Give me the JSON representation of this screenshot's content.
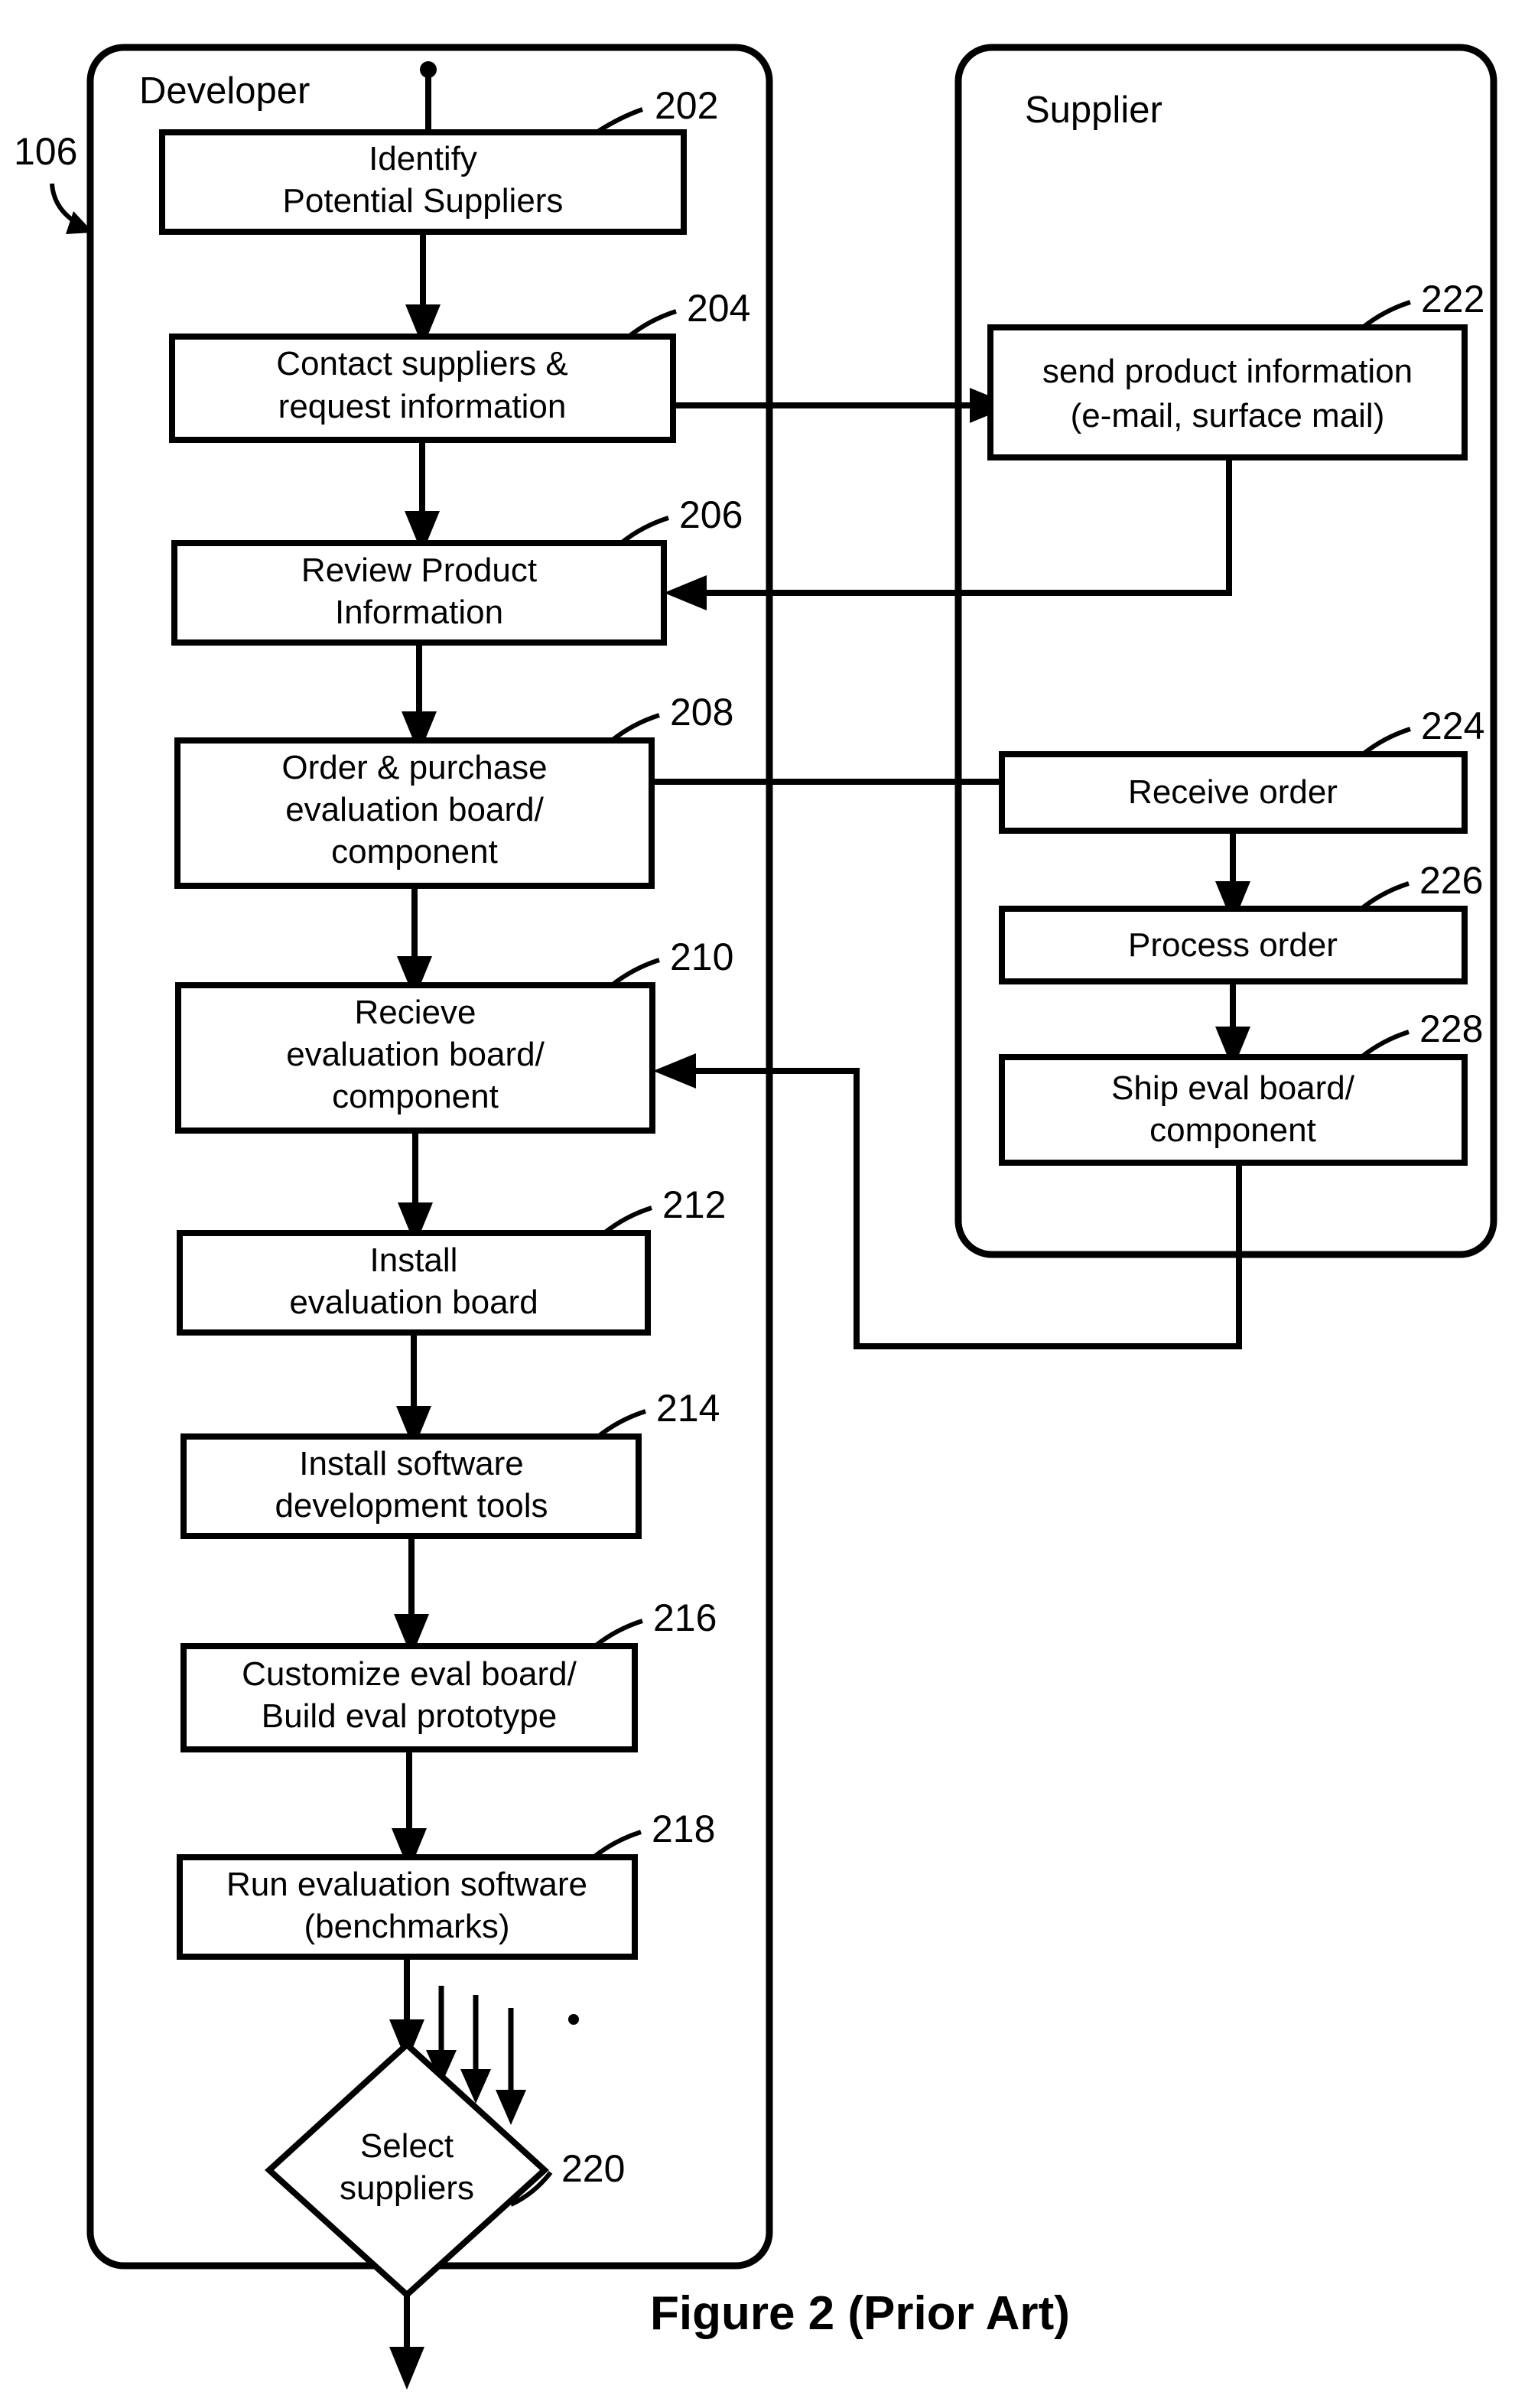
{
  "figure": {
    "caption": "Figure 2 (Prior Art)",
    "diagram_ref": "106"
  },
  "lanes": [
    {
      "id": "developer",
      "title": "Developer"
    },
    {
      "id": "supplier",
      "title": "Supplier"
    }
  ],
  "nodes": {
    "n202": {
      "ref": "202",
      "line1": "Identify",
      "line2": "Potential Suppliers",
      "line3": ""
    },
    "n204": {
      "ref": "204",
      "line1": "Contact suppliers &",
      "line2": "request information",
      "line3": ""
    },
    "n206": {
      "ref": "206",
      "line1": "Review Product",
      "line2": "Information",
      "line3": ""
    },
    "n208": {
      "ref": "208",
      "line1": "Order & purchase",
      "line2": "evaluation board/",
      "line3": "component"
    },
    "n210": {
      "ref": "210",
      "line1": "Recieve",
      "line2": "evaluation board/",
      "line3": "component"
    },
    "n212": {
      "ref": "212",
      "line1": "Install",
      "line2": "evaluation board",
      "line3": ""
    },
    "n214": {
      "ref": "214",
      "line1": "Install software",
      "line2": "development tools",
      "line3": ""
    },
    "n216": {
      "ref": "216",
      "line1": "Customize eval board/",
      "line2": "Build eval prototype",
      "line3": ""
    },
    "n218": {
      "ref": "218",
      "line1": "Run evaluation software",
      "line2": "(benchmarks)",
      "line3": ""
    },
    "n220": {
      "ref": "220",
      "line1": "Select",
      "line2": "suppliers",
      "line3": ""
    },
    "n222": {
      "ref": "222",
      "line1": "send product information",
      "line2": "(e-mail, surface mail)",
      "line3": ""
    },
    "n224": {
      "ref": "224",
      "line1": "Receive order",
      "line2": "",
      "line3": ""
    },
    "n226": {
      "ref": "226",
      "line1": "Process order",
      "line2": "",
      "line3": ""
    },
    "n228": {
      "ref": "228",
      "line1": "Ship eval board/",
      "line2": "component",
      "line3": ""
    }
  },
  "colors": {
    "ink": "#000000",
    "paper": "#ffffff"
  }
}
